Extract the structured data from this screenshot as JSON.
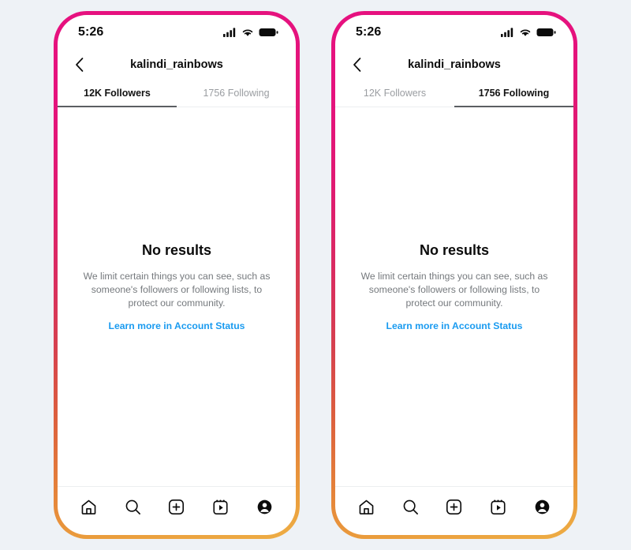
{
  "background_color": "#eef2f6",
  "accent": {
    "link_blue": "#1a9bf0",
    "gradient_top": "#e6117f",
    "gradient_bottom": "#eeae45",
    "active_text": "#121212",
    "inactive_text": "#9a9da1",
    "body_text": "#75797d"
  },
  "phones": [
    {
      "id": "phone-followers",
      "status_bar": {
        "time": "5:26",
        "icons": [
          "signal-icon",
          "wifi-icon",
          "battery-icon"
        ]
      },
      "header": {
        "back_icon": "chevron-left-icon",
        "title": "kalindi_rainbows"
      },
      "tabs": [
        {
          "label": "12K Followers",
          "active": true
        },
        {
          "label": "1756 Following",
          "active": false
        }
      ],
      "empty_state": {
        "title": "No results",
        "body": "We limit certain things you can see, such as someone's followers or following lists, to protect our community.",
        "link": "Learn more in Account Status"
      },
      "bottom_nav": [
        {
          "icon": "home-icon",
          "active": false
        },
        {
          "icon": "search-icon",
          "active": false
        },
        {
          "icon": "add-post-icon",
          "active": false
        },
        {
          "icon": "reels-icon",
          "active": false
        },
        {
          "icon": "profile-icon",
          "active": true
        }
      ]
    },
    {
      "id": "phone-following",
      "status_bar": {
        "time": "5:26",
        "icons": [
          "signal-icon",
          "wifi-icon",
          "battery-icon"
        ]
      },
      "header": {
        "back_icon": "chevron-left-icon",
        "title": "kalindi_rainbows"
      },
      "tabs": [
        {
          "label": "12K Followers",
          "active": false
        },
        {
          "label": "1756 Following",
          "active": true
        }
      ],
      "empty_state": {
        "title": "No results",
        "body": "We limit certain things you can see, such as someone's followers or following lists, to protect our community.",
        "link": "Learn more in Account Status"
      },
      "bottom_nav": [
        {
          "icon": "home-icon",
          "active": false
        },
        {
          "icon": "search-icon",
          "active": false
        },
        {
          "icon": "add-post-icon",
          "active": false
        },
        {
          "icon": "reels-icon",
          "active": false
        },
        {
          "icon": "profile-icon",
          "active": true
        }
      ]
    }
  ]
}
